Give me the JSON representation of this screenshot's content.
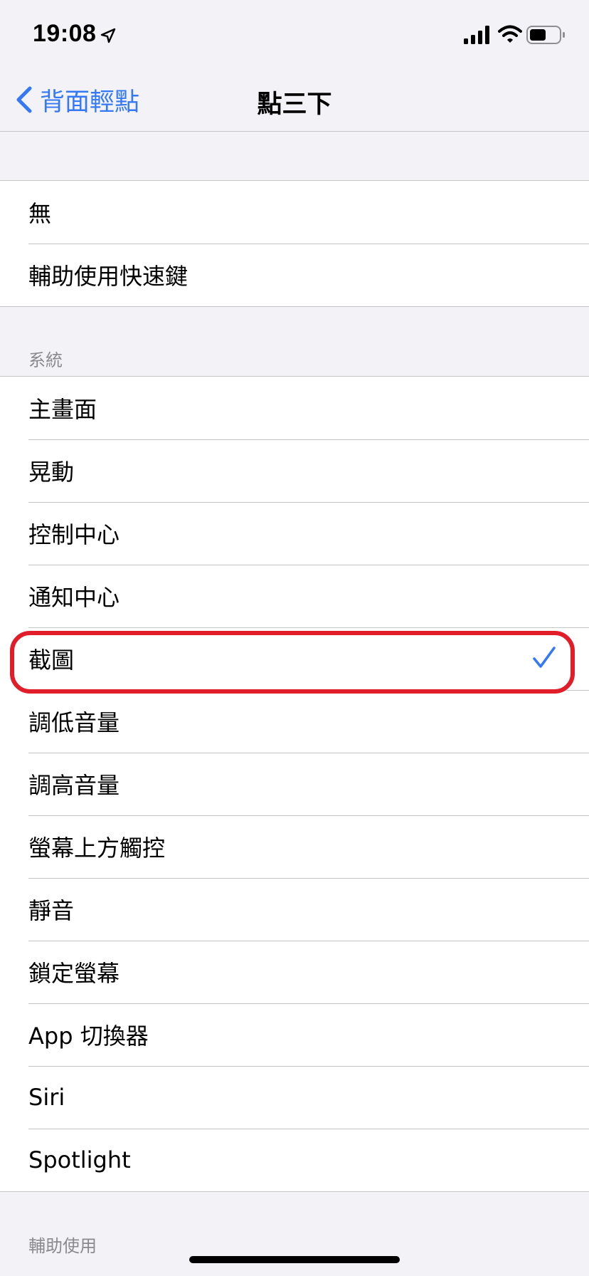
{
  "status_bar": {
    "time": "19:08",
    "icons": [
      "location-arrow-icon",
      "cellular-signal-icon",
      "wifi-icon",
      "battery-icon"
    ]
  },
  "nav": {
    "back_label": "背面輕點",
    "title": "點三下"
  },
  "group_top": {
    "items": [
      {
        "label": "無"
      },
      {
        "label": "輔助使用快速鍵"
      }
    ]
  },
  "system_section": {
    "header": "系統",
    "items": [
      {
        "label": "主畫面"
      },
      {
        "label": "晃動"
      },
      {
        "label": "控制中心"
      },
      {
        "label": "通知中心"
      },
      {
        "label": "截圖",
        "selected": true
      },
      {
        "label": "調低音量"
      },
      {
        "label": "調高音量"
      },
      {
        "label": "螢幕上方觸控"
      },
      {
        "label": "靜音"
      },
      {
        "label": "鎖定螢幕"
      },
      {
        "label": "App 切換器"
      },
      {
        "label": "Siri"
      },
      {
        "label": "Spotlight"
      }
    ]
  },
  "accessibility_section": {
    "header": "輔助使用"
  },
  "colors": {
    "accent": "#3478f6",
    "highlight": "#e11d2a",
    "separator": "#c6c6c8",
    "background": "#f2f2f7"
  }
}
